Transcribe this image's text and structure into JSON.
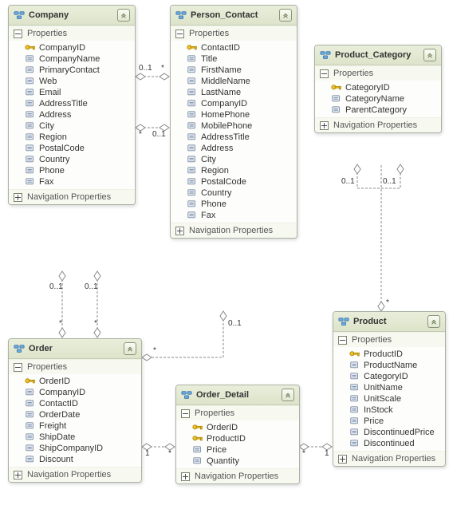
{
  "entities": {
    "company": {
      "title": "Company",
      "propsLabel": "Properties",
      "navLabel": "Navigation Properties",
      "props": [
        {
          "name": "CompanyID",
          "key": true
        },
        {
          "name": "CompanyName",
          "key": false
        },
        {
          "name": "PrimaryContact",
          "key": false
        },
        {
          "name": "Web",
          "key": false
        },
        {
          "name": "Email",
          "key": false
        },
        {
          "name": "AddressTitle",
          "key": false
        },
        {
          "name": "Address",
          "key": false
        },
        {
          "name": "City",
          "key": false
        },
        {
          "name": "Region",
          "key": false
        },
        {
          "name": "PostalCode",
          "key": false
        },
        {
          "name": "Country",
          "key": false
        },
        {
          "name": "Phone",
          "key": false
        },
        {
          "name": "Fax",
          "key": false
        }
      ]
    },
    "person": {
      "title": "Person_Contact",
      "propsLabel": "Properties",
      "navLabel": "Navigation Properties",
      "props": [
        {
          "name": "ContactID",
          "key": true
        },
        {
          "name": "Title",
          "key": false
        },
        {
          "name": "FirstName",
          "key": false
        },
        {
          "name": "MiddleName",
          "key": false
        },
        {
          "name": "LastName",
          "key": false
        },
        {
          "name": "CompanyID",
          "key": false
        },
        {
          "name": "HomePhone",
          "key": false
        },
        {
          "name": "MobilePhone",
          "key": false
        },
        {
          "name": "AddressTitle",
          "key": false
        },
        {
          "name": "Address",
          "key": false
        },
        {
          "name": "City",
          "key": false
        },
        {
          "name": "Region",
          "key": false
        },
        {
          "name": "PostalCode",
          "key": false
        },
        {
          "name": "Country",
          "key": false
        },
        {
          "name": "Phone",
          "key": false
        },
        {
          "name": "Fax",
          "key": false
        }
      ]
    },
    "category": {
      "title": "Product_Category",
      "propsLabel": "Properties",
      "navLabel": "Navigation Properties",
      "props": [
        {
          "name": "CategoryID",
          "key": true
        },
        {
          "name": "CategoryName",
          "key": false
        },
        {
          "name": "ParentCategory",
          "key": false
        }
      ]
    },
    "order": {
      "title": "Order",
      "propsLabel": "Properties",
      "navLabel": "Navigation Properties",
      "props": [
        {
          "name": "OrderID",
          "key": true
        },
        {
          "name": "CompanyID",
          "key": false
        },
        {
          "name": "ContactID",
          "key": false
        },
        {
          "name": "OrderDate",
          "key": false
        },
        {
          "name": "Freight",
          "key": false
        },
        {
          "name": "ShipDate",
          "key": false
        },
        {
          "name": "ShipCompanyID",
          "key": false
        },
        {
          "name": "Discount",
          "key": false
        }
      ]
    },
    "detail": {
      "title": "Order_Detail",
      "propsLabel": "Properties",
      "navLabel": "Navigation Properties",
      "props": [
        {
          "name": "OrderID",
          "key": true
        },
        {
          "name": "ProductID",
          "key": true
        },
        {
          "name": "Price",
          "key": false
        },
        {
          "name": "Quantity",
          "key": false
        }
      ]
    },
    "product": {
      "title": "Product",
      "propsLabel": "Properties",
      "navLabel": "Navigation Properties",
      "props": [
        {
          "name": "ProductID",
          "key": true
        },
        {
          "name": "ProductName",
          "key": false
        },
        {
          "name": "CategoryID",
          "key": false
        },
        {
          "name": "UnitName",
          "key": false
        },
        {
          "name": "UnitScale",
          "key": false
        },
        {
          "name": "InStock",
          "key": false
        },
        {
          "name": "Price",
          "key": false
        },
        {
          "name": "DiscontinuedPrice",
          "key": false
        },
        {
          "name": "Discontinued",
          "key": false
        }
      ]
    }
  },
  "mult": {
    "c_p_left": "0..1",
    "c_p_right": "*",
    "p_c_left": "*",
    "p_c_right": "0..1",
    "co_a": "0..1",
    "co_b": "0..1",
    "co_c": "*",
    "co_d": "*",
    "po_o": "0..1",
    "po_o2": "*",
    "od_l": "1",
    "od_r": "*",
    "pd_l": "*",
    "pd_r": "1",
    "cat_a": "0..1",
    "cat_b": "0..1",
    "pc_t": "*"
  }
}
